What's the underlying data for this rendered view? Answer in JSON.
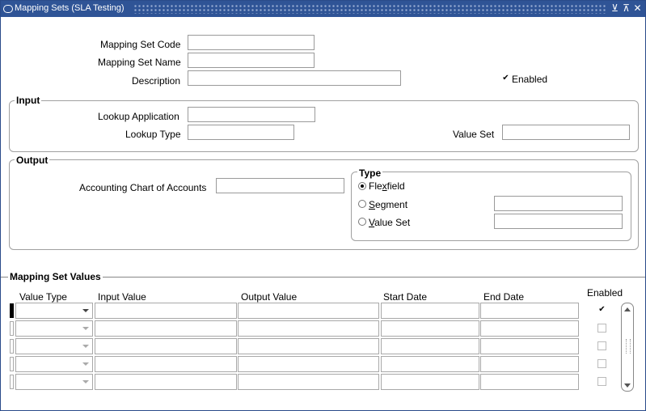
{
  "window": {
    "title": "Mapping Sets (SLA Testing)",
    "controls": {
      "minimize": "⊻",
      "maximize": "⊼",
      "close": "✕"
    }
  },
  "header_fields": {
    "mapping_set_code_label": "Mapping Set Code",
    "mapping_set_code_value": "",
    "mapping_set_name_label": "Mapping Set Name",
    "mapping_set_name_value": "",
    "description_label": "Description",
    "description_value": "",
    "enabled_label": "Enabled",
    "enabled_checked": true
  },
  "input_group": {
    "title": "Input",
    "lookup_application_label": "Lookup Application",
    "lookup_application_value": "",
    "lookup_type_label": "Lookup Type",
    "lookup_type_value": "",
    "value_set_label": "Value Set",
    "value_set_value": ""
  },
  "output_group": {
    "title": "Output",
    "accounting_coa_label": "Accounting Chart of Accounts",
    "accounting_coa_value": "",
    "type": {
      "title": "Type",
      "options": [
        {
          "label_pre": "Fle",
          "label_u": "x",
          "label_post": "field",
          "selected": true
        },
        {
          "label_pre": "",
          "label_u": "S",
          "label_post": "egment",
          "selected": false
        },
        {
          "label_pre": "",
          "label_u": "V",
          "label_post": "alue Set",
          "selected": false
        }
      ],
      "segment_value": "",
      "value_set_value": ""
    }
  },
  "mapping_set_values": {
    "title": "Mapping Set Values",
    "columns": {
      "value_type": "Value Type",
      "input_value": "Input Value",
      "output_value": "Output Value",
      "start_date": "Start Date",
      "end_date": "End Date",
      "enabled": "Enabled"
    },
    "rows": [
      {
        "value_type": "",
        "input_value": "",
        "output_value": "",
        "start_date": "",
        "end_date": "",
        "enabled": true,
        "current": true
      },
      {
        "value_type": "",
        "input_value": "",
        "output_value": "",
        "start_date": "",
        "end_date": "",
        "enabled": false,
        "current": false
      },
      {
        "value_type": "",
        "input_value": "",
        "output_value": "",
        "start_date": "",
        "end_date": "",
        "enabled": false,
        "current": false
      },
      {
        "value_type": "",
        "input_value": "",
        "output_value": "",
        "start_date": "",
        "end_date": "",
        "enabled": false,
        "current": false
      },
      {
        "value_type": "",
        "input_value": "",
        "output_value": "",
        "start_date": "",
        "end_date": "",
        "enabled": false,
        "current": false
      }
    ]
  },
  "colors": {
    "title_bar": "#2f5496",
    "border": "#a0a0a0"
  }
}
